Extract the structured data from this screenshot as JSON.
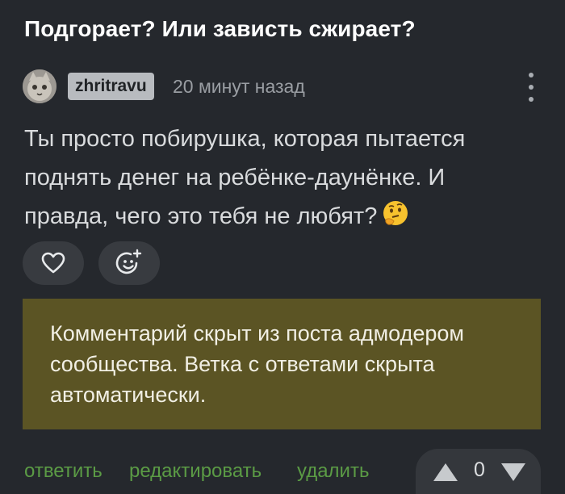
{
  "post": {
    "title": "Подгорает? Или зависть сжирает?"
  },
  "comment": {
    "username": "zhritravu",
    "time": "20 минут назад",
    "text": "Ты просто побирушка, которая пытается поднять денег на ребёнке-даунёнке. И правда, чего это тебя не любят?",
    "emoji": "thinking-face-icon"
  },
  "notice": {
    "text": "Комментарий скрыт из поста адмодером сообщества. Ветка с ответами скрыта автоматически."
  },
  "footer": {
    "reply": "ответить",
    "edit": "редактировать",
    "delete": "удалить",
    "votes": "0"
  },
  "colors": {
    "background": "#25282d",
    "link": "#5b9b45",
    "notice_bg": "#5b5424",
    "username_badge": "#b8bbbf"
  }
}
